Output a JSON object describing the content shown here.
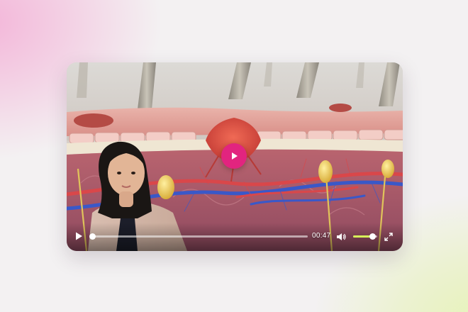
{
  "player": {
    "time_label": "00:47",
    "progress_fraction": 0.0,
    "volume_fraction": 0.78
  },
  "icons": {
    "big_play": "play-icon",
    "play": "play-icon",
    "volume": "volume-icon",
    "fullscreen": "fullscreen-icon"
  },
  "colors": {
    "accent_play": "#e2247f",
    "volume_fill": "#d7f35a",
    "epidermis": "#e7a39c",
    "artery": "#d9474a",
    "vein": "#3a58c8"
  }
}
